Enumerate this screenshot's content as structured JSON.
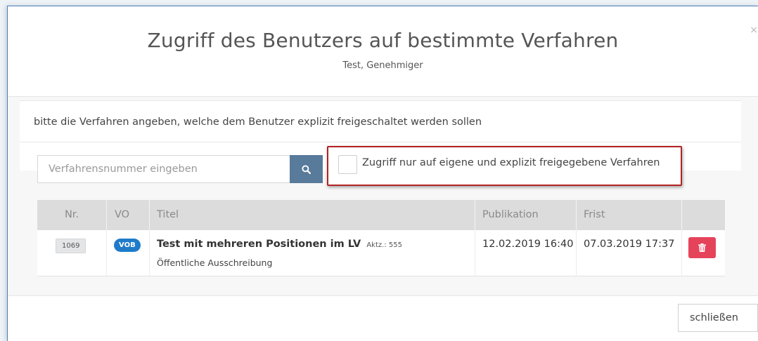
{
  "modal": {
    "title": "Zugriff des Benutzers auf bestimmte Verfahren",
    "subtitle": "Test, Genehmiger",
    "close_glyph": "×"
  },
  "panel": {
    "heading": "bitte die Verfahren angeben, welche dem Benutzer explizit freigeschaltet werden sollen"
  },
  "search": {
    "placeholder": "Verfahrensnummer eingeben",
    "icon": "search-icon"
  },
  "checkbox": {
    "label": "Zugriff nur auf eigene und explizit freigegebene Verfahren",
    "checked": false
  },
  "table": {
    "columns": [
      "Nr.",
      "VO",
      "Titel",
      "Publikation",
      "Frist",
      ""
    ],
    "rows": [
      {
        "nr": "1069",
        "vo": "VOB",
        "title": "Test mit mehreren Positionen im LV",
        "aktz": "Aktz.: 555",
        "subtitle": "Öffentliche Ausschreibung",
        "publikation": "12.02.2019 16:40",
        "frist": "07.03.2019 17:37",
        "action_icon": "trash-icon"
      }
    ]
  },
  "footer": {
    "close_label": "schließen"
  },
  "colors": {
    "accent_blue": "#1f7bc9",
    "search_button": "#587a9b",
    "delete_button": "#e5435a",
    "highlight_border": "#b22222"
  }
}
